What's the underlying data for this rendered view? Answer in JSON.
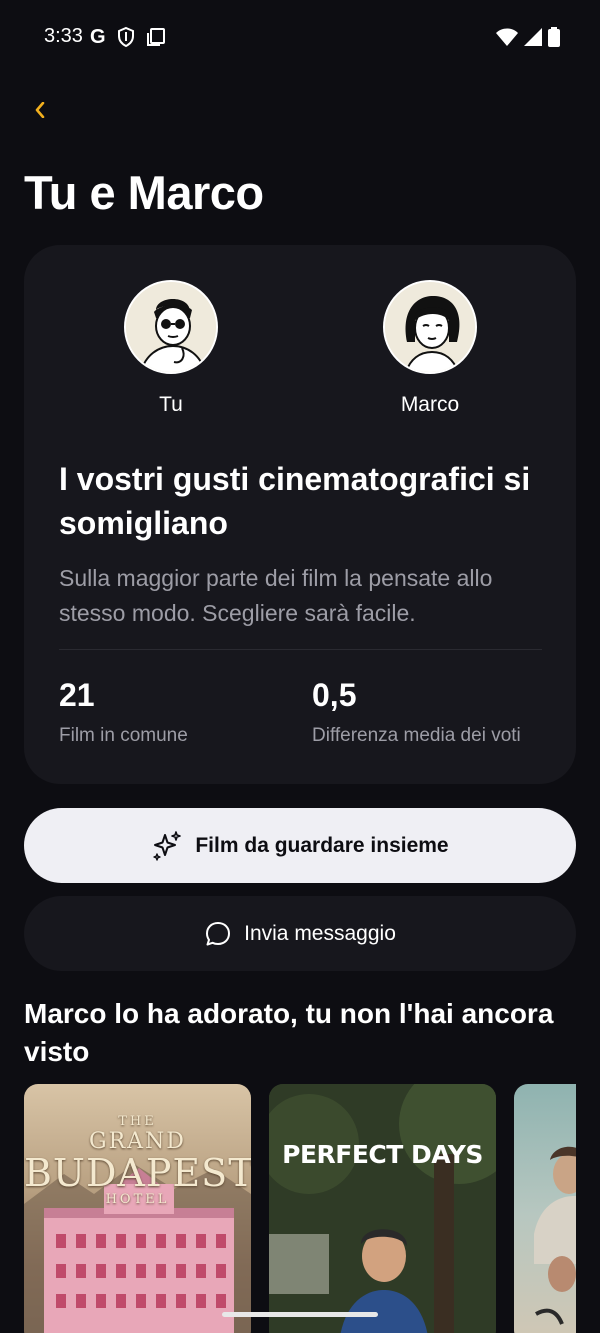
{
  "status_bar": {
    "time": "3:33",
    "g_label": "G"
  },
  "header": {
    "title": "Tu e Marco"
  },
  "comparison_card": {
    "left_user": {
      "name": "Tu"
    },
    "right_user": {
      "name": "Marco"
    },
    "headline": "I vostri gusti cinematografici si somigliano",
    "description": "Sulla maggior parte dei film la pensate allo stesso modo. Scegliere sarà facile.",
    "stats": [
      {
        "value": "21",
        "label": "Film in comune"
      },
      {
        "value": "0,5",
        "label": "Differenza media dei voti"
      }
    ]
  },
  "actions": {
    "watch_together_label": "Film da guardare insieme",
    "send_message_label": "Invia messaggio"
  },
  "recommendations": {
    "title": "Marco lo ha adorato, tu non l'hai ancora visto",
    "posters": [
      {
        "line1": "THE",
        "line2": "GRAND",
        "line3": "BUDAPEST",
        "line4": "HOTEL"
      },
      {
        "title": "PERFECT DAYS"
      },
      {
        "title": ""
      }
    ]
  },
  "colors": {
    "background": "#0d0d12",
    "card": "#17171d",
    "accent": "#f2b01e",
    "primary_button": "#efeff4"
  }
}
